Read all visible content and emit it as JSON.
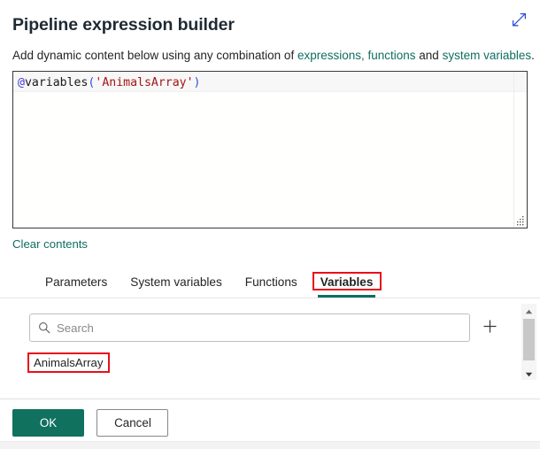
{
  "window": {
    "title": "Pipeline expression builder",
    "expand_icon": "expand-diagonal-icon"
  },
  "subtitle": {
    "prefix": "Add dynamic content below using any combination of ",
    "link_expressions": "expressions, functions",
    "middle": " and ",
    "link_system_variables": "system variables",
    "suffix": "."
  },
  "editor": {
    "tokens": {
      "at": "@",
      "function": "variables",
      "open_paren": "(",
      "string": "'AnimalsArray'",
      "close_paren": ")"
    },
    "full_text": "@variables('AnimalsArray')",
    "resize_handle": "resize-grip-icon"
  },
  "clear": {
    "label": "Clear contents"
  },
  "tabs": [
    {
      "label": "Parameters",
      "active": false
    },
    {
      "label": "System variables",
      "active": false
    },
    {
      "label": "Functions",
      "active": false
    },
    {
      "label": "Variables",
      "active": true
    }
  ],
  "search": {
    "placeholder": "Search",
    "value": "",
    "icon": "search-icon",
    "add_icon": "plus-icon"
  },
  "variables_list": [
    {
      "name": "AnimalsArray"
    }
  ],
  "scrollbar": {
    "up_icon": "caret-up-icon",
    "down_icon": "caret-down-icon"
  },
  "footer": {
    "ok_label": "OK",
    "cancel_label": "Cancel"
  },
  "colors": {
    "brand_teal": "#10715f",
    "link_teal": "#0f6e62",
    "annotation_red": "#e8101a",
    "string_token": "#a31515",
    "at_token": "#3b3bd6",
    "paren_token": "#2d4fd6"
  },
  "annotations": [
    {
      "target": "tab-variables"
    },
    {
      "target": "variable-item-animalsarray"
    }
  ]
}
